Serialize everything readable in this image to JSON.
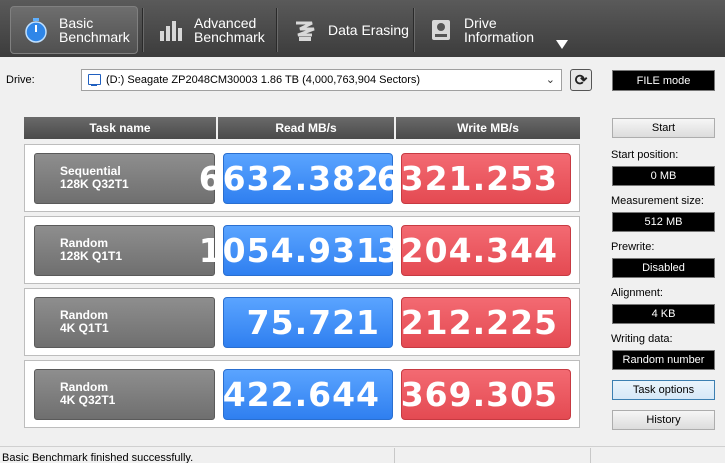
{
  "tabs": [
    {
      "line1": "Basic",
      "line2": "Benchmark",
      "icon": "stopwatch-icon",
      "active": true
    },
    {
      "line1": "Advanced",
      "line2": "Benchmark",
      "icon": "bar-chart-icon",
      "active": false
    },
    {
      "line1": "Data Erasing",
      "line2": "",
      "icon": "eraser-icon",
      "active": false
    },
    {
      "line1": "Drive",
      "line2": "Information",
      "icon": "drive-info-icon",
      "active": false
    }
  ],
  "drive": {
    "label": "Drive:",
    "selected": "(D:) Seagate ZP2048CM30003  1.86 TB (4,000,763,904 Sectors)",
    "mode": "FILE mode"
  },
  "table": {
    "headers": [
      "Task name",
      "Read MB/s",
      "Write MB/s"
    ],
    "rows": [
      {
        "task_line1": "Sequential",
        "task_line2": "128K Q32T1",
        "read": "6632.382",
        "write": "6321.253"
      },
      {
        "task_line1": "Random",
        "task_line2": "128K Q1T1",
        "read": "1054.931",
        "write": "3204.344"
      },
      {
        "task_line1": "Random",
        "task_line2": "4K Q1T1",
        "read": "75.721",
        "write": "212.225"
      },
      {
        "task_line1": "Random",
        "task_line2": "4K Q32T1",
        "read": "422.644",
        "write": "369.305"
      }
    ]
  },
  "controls": {
    "start_label": "Start",
    "start_position_label": "Start position:",
    "start_position_value": "0 MB",
    "measurement_size_label": "Measurement size:",
    "measurement_size_value": "512 MB",
    "prewrite_label": "Prewrite:",
    "prewrite_value": "Disabled",
    "alignment_label": "Alignment:",
    "alignment_value": "4 KB",
    "writing_data_label": "Writing data:",
    "writing_data_value": "Random number",
    "task_options_label": "Task options",
    "history_label": "History"
  },
  "status": {
    "message": "Basic Benchmark finished successfully."
  },
  "colors": {
    "read": "#3d8ef8",
    "write": "#ec5860",
    "task": "#7d7d7d"
  }
}
